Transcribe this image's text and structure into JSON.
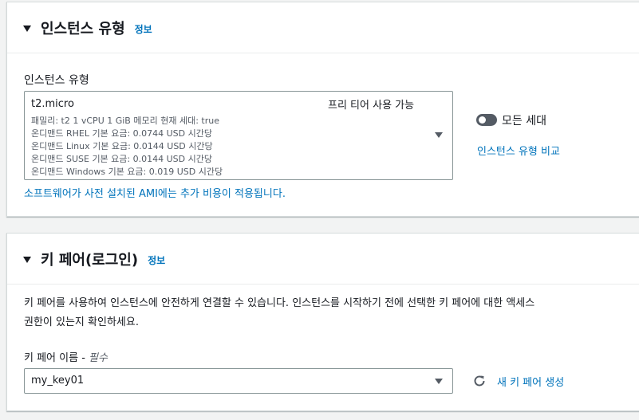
{
  "instance_panel": {
    "title": "인스턴스 유형",
    "info": "정보",
    "field_label": "인스턴스 유형",
    "selected": {
      "name": "t2.micro",
      "badge": "프리 티어 사용 가능",
      "details": [
        "패밀리: t2    1 vCPU    1 GiB 메모리    현재 세대: true",
        "온디맨드 RHEL 기본 요금: 0.0744 USD 시간당",
        "온디맨드 Linux 기본 요금: 0.0144 USD 시간당",
        "온디맨드 SUSE 기본 요금: 0.0144 USD 시간당",
        "온디맨드 Windows 기본 요금: 0.019 USD 시간당"
      ]
    },
    "all_generations_label": "모든 세대",
    "compare_link": "인스턴스 유형 비교",
    "ami_note": "소프트웨어가 사전 설치된 AMI에는 추가 비용이 적용됩니다."
  },
  "keypair_panel": {
    "title": "키 페어(로그인)",
    "info": "정보",
    "description_line1": "키 페어를 사용하여 인스턴스에 안전하게 연결할 수 있습니다. 인스턴스를 시작하기 전에 선택한 키 페어에 대한 액세스",
    "description_line2": "권한이 있는지 확인하세요.",
    "field_label": "키 페어 이름 - ",
    "required": "필수",
    "selected_key": "my_key01",
    "new_key_link": "새 키 페어 생성"
  },
  "icons": {
    "caret": "caret-down-icon",
    "refresh": "refresh-icon",
    "toggle": "toggle-off"
  },
  "colors": {
    "link": "#0073bb",
    "text": "#16191f",
    "muted": "#545b64",
    "background": "#f2f3f3"
  }
}
